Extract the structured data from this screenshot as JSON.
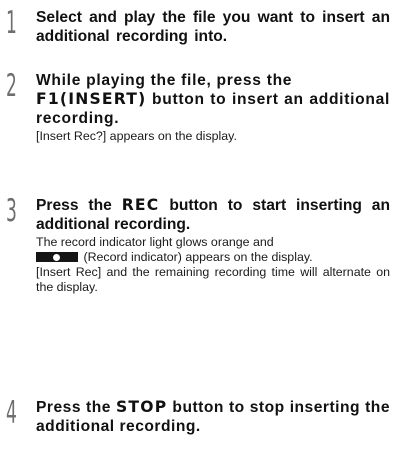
{
  "steps": [
    {
      "number": "1",
      "title": "Select and play the file you want to insert an additional recording into."
    },
    {
      "number": "2",
      "title_part1": "While playing the file, press the",
      "title_kw": "F1(INSERT)",
      "title_part2": " button to insert an additional recording.",
      "note": "[Insert Rec?] appears on the display."
    },
    {
      "number": "3",
      "title_part1": "Press the ",
      "title_kw": "REC",
      "title_part2": " button to start inserting an additional recording.",
      "body_line1": "The record indicator light glows orange and",
      "indicator_icon": "record-indicator-icon",
      "body_line2": " (Record indicator) appears on the display.",
      "body_line3": "[Insert Rec] and the remaining recording time will alternate on the display."
    },
    {
      "number": "4",
      "title_part1": "Press the ",
      "title_kw": "STOP",
      "title_part2": " button to stop inserting the additional recording."
    }
  ]
}
